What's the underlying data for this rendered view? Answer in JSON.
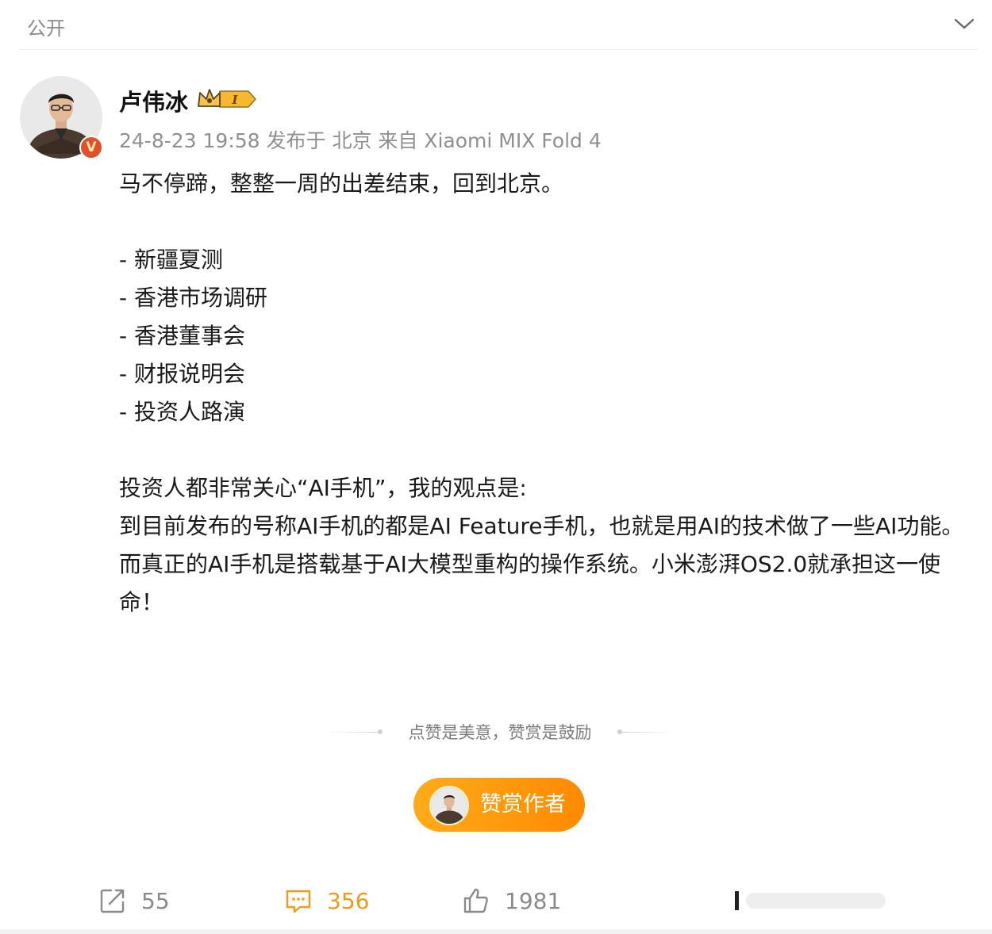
{
  "topbar": {
    "visibility_label": "公开"
  },
  "post": {
    "author": {
      "name": "卢伟冰",
      "level_badge_text": "I",
      "verified_mark": "V"
    },
    "meta": "24-8-23 19:58 发布于 北京 来自 Xiaomi MIX Fold 4",
    "content": {
      "intro": "马不停蹄，整整一周的出差结束，回到北京。",
      "list": [
        "- 新疆夏测",
        "- 香港市场调研",
        "- 香港董事会",
        "- 财报说明会",
        "- 投资人路演"
      ],
      "paragraphs": [
        "投资人都非常关心“AI手机”，我的观点是:",
        "到目前发布的号称AI手机的都是AI Feature手机，也就是用AI的技术做了一些AI功能。",
        "而真正的AI手机是搭载基于AI大模型重构的操作系统。小米澎湃OS2.0就承担这一使命！"
      ]
    }
  },
  "reward": {
    "tagline": "点赞是美意，赞赏是鼓励",
    "button_label": "赞赏作者"
  },
  "actions": {
    "repost_count": "55",
    "comment_count": "356",
    "like_count": "1981"
  },
  "colors": {
    "accent_orange": "#ff9a0f",
    "comment_orange": "#f59a14",
    "muted_text": "#8f8f8f",
    "verified_red": "#e0502d"
  },
  "icons": [
    "chevron-down-icon",
    "crown-icon",
    "verified-icon",
    "share-icon",
    "comment-icon",
    "like-icon"
  ]
}
